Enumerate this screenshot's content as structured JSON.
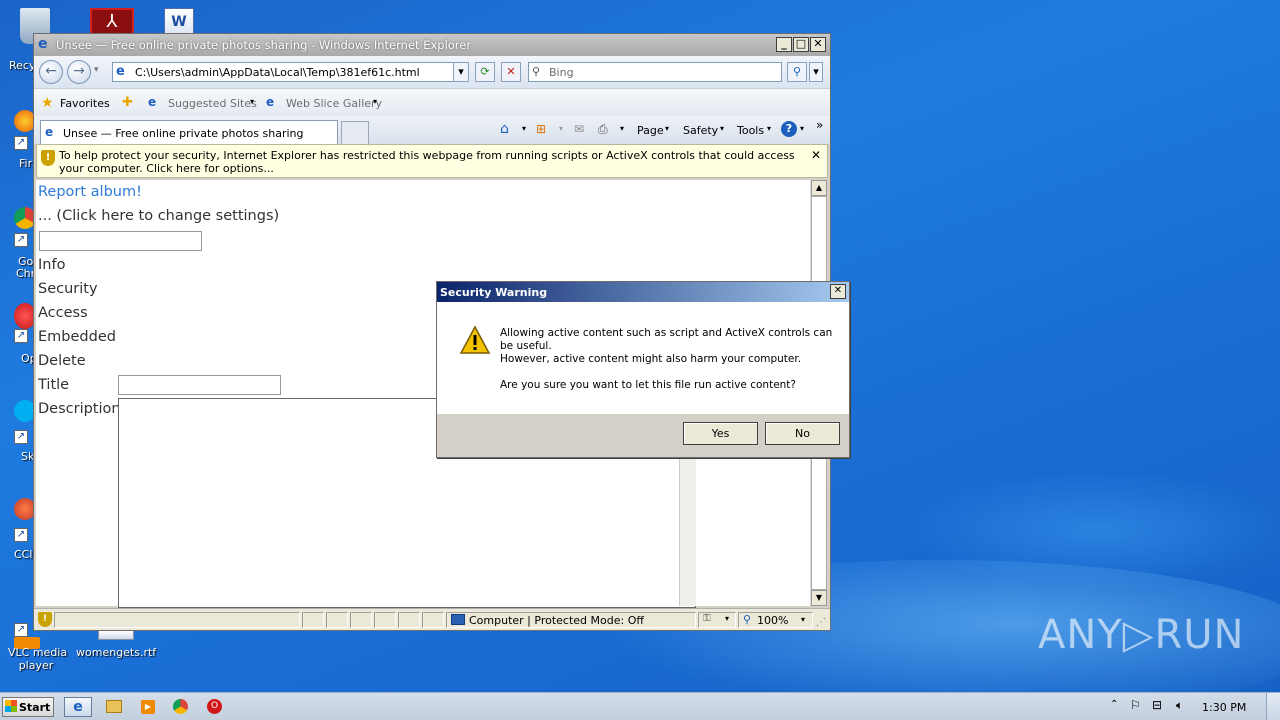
{
  "desktop": {
    "icons": [
      {
        "label": "Recy"
      },
      {
        "label": "Fir"
      },
      {
        "label": "Go\nChr"
      },
      {
        "label": "Op"
      },
      {
        "label": "Sk"
      },
      {
        "label": "CCl"
      },
      {
        "label": "VLC media\nplayer"
      },
      {
        "label": "womengets.rtf"
      }
    ],
    "watermark": "ANY▷RUN"
  },
  "ie": {
    "title": "Unsee — Free online private photos sharing - Windows Internet Explorer",
    "address": "C:\\Users\\admin\\AppData\\Local\\Temp\\381ef61c.html",
    "search_placeholder": "Bing",
    "favorites": {
      "favorites": "Favorites",
      "suggested": "Suggested Sites",
      "webslice": "Web Slice Gallery"
    },
    "tab_label": "Unsee — Free online private photos sharing",
    "commands": {
      "page": "Page",
      "safety": "Safety",
      "tools": "Tools"
    },
    "infobar": "To help protect your security, Internet Explorer has restricted this webpage from running scripts or ActiveX controls that could access your computer. Click here for options...",
    "page": {
      "report": "Report album!",
      "settings": "... (Click here to change settings)",
      "info": "Info",
      "security": "Security",
      "access": "Access",
      "embedded": "Embedded",
      "delete": "Delete",
      "title_label": "Title",
      "description_label": "Description"
    },
    "status": {
      "zone": "Computer | Protected Mode: Off",
      "zoom": "100%"
    }
  },
  "dialog": {
    "title": "Security Warning",
    "line1": "Allowing active content such as script and ActiveX controls can be useful.",
    "line2": "However, active content might also harm your computer.",
    "line3": "Are you sure you want to let this file run active content?",
    "yes": "Yes",
    "no": "No"
  },
  "taskbar": {
    "start": "Start",
    "time": "1:30 PM"
  }
}
